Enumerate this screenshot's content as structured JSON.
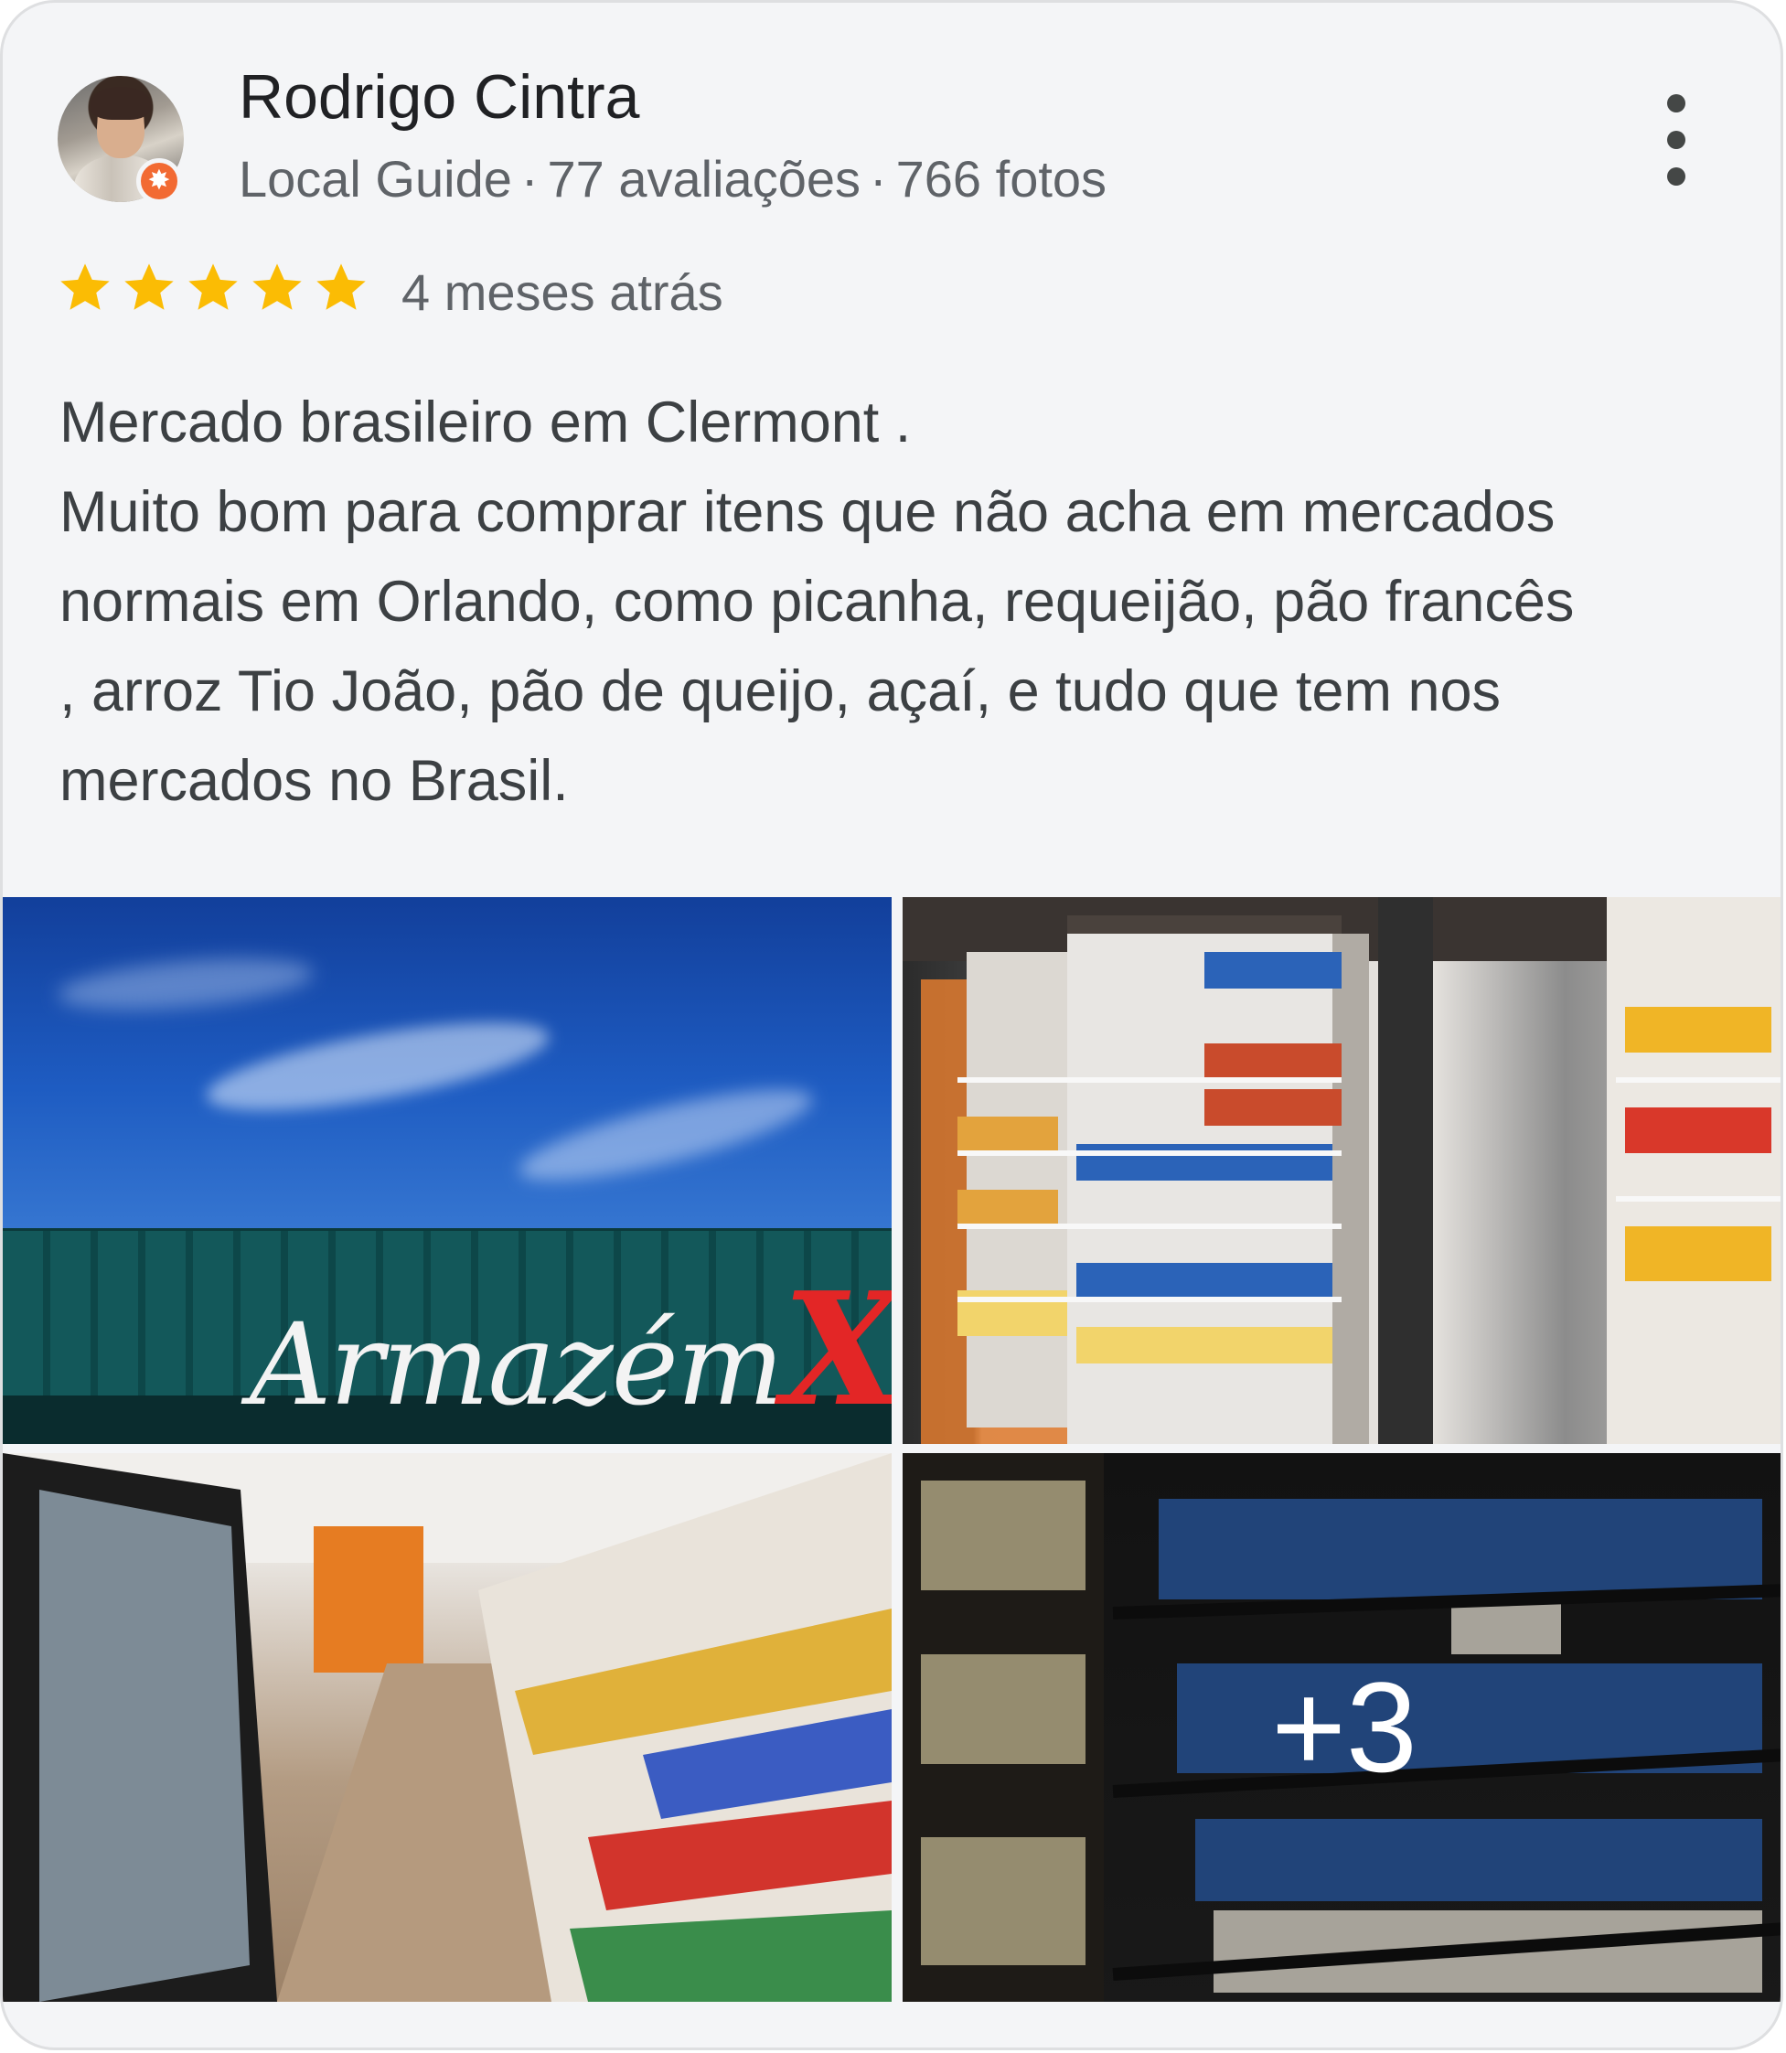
{
  "reviewer": {
    "name": "Rodrigo Cintra",
    "role": "Local Guide",
    "reviews": "77 avaliações",
    "photos": "766 fotos",
    "separator": "·",
    "avatar_icon": "person-avatar",
    "badge_icon": "local-guide-badge"
  },
  "rating": {
    "stars": 5,
    "max": 5,
    "star_color": "#fbbc04",
    "time_ago": "4 meses atrás"
  },
  "review_lines": [
    "Mercado brasileiro em Clermont .",
    "Muito bom para comprar itens que não acha em mercados",
    "normais em Orlando, como picanha, requeijão, pão francês",
    ", arroz Tio João, pão de queijo, açaí, e tudo que tem nos",
    "mercados no Brasil."
  ],
  "photos": {
    "store_sign_a": "Armazém",
    "store_sign_b": "X",
    "more_count": "+3"
  },
  "colors": {
    "card_bg": "#f4f5f7",
    "badge": "#f26a33",
    "text_primary": "#202124",
    "text_secondary": "#5f6368"
  }
}
